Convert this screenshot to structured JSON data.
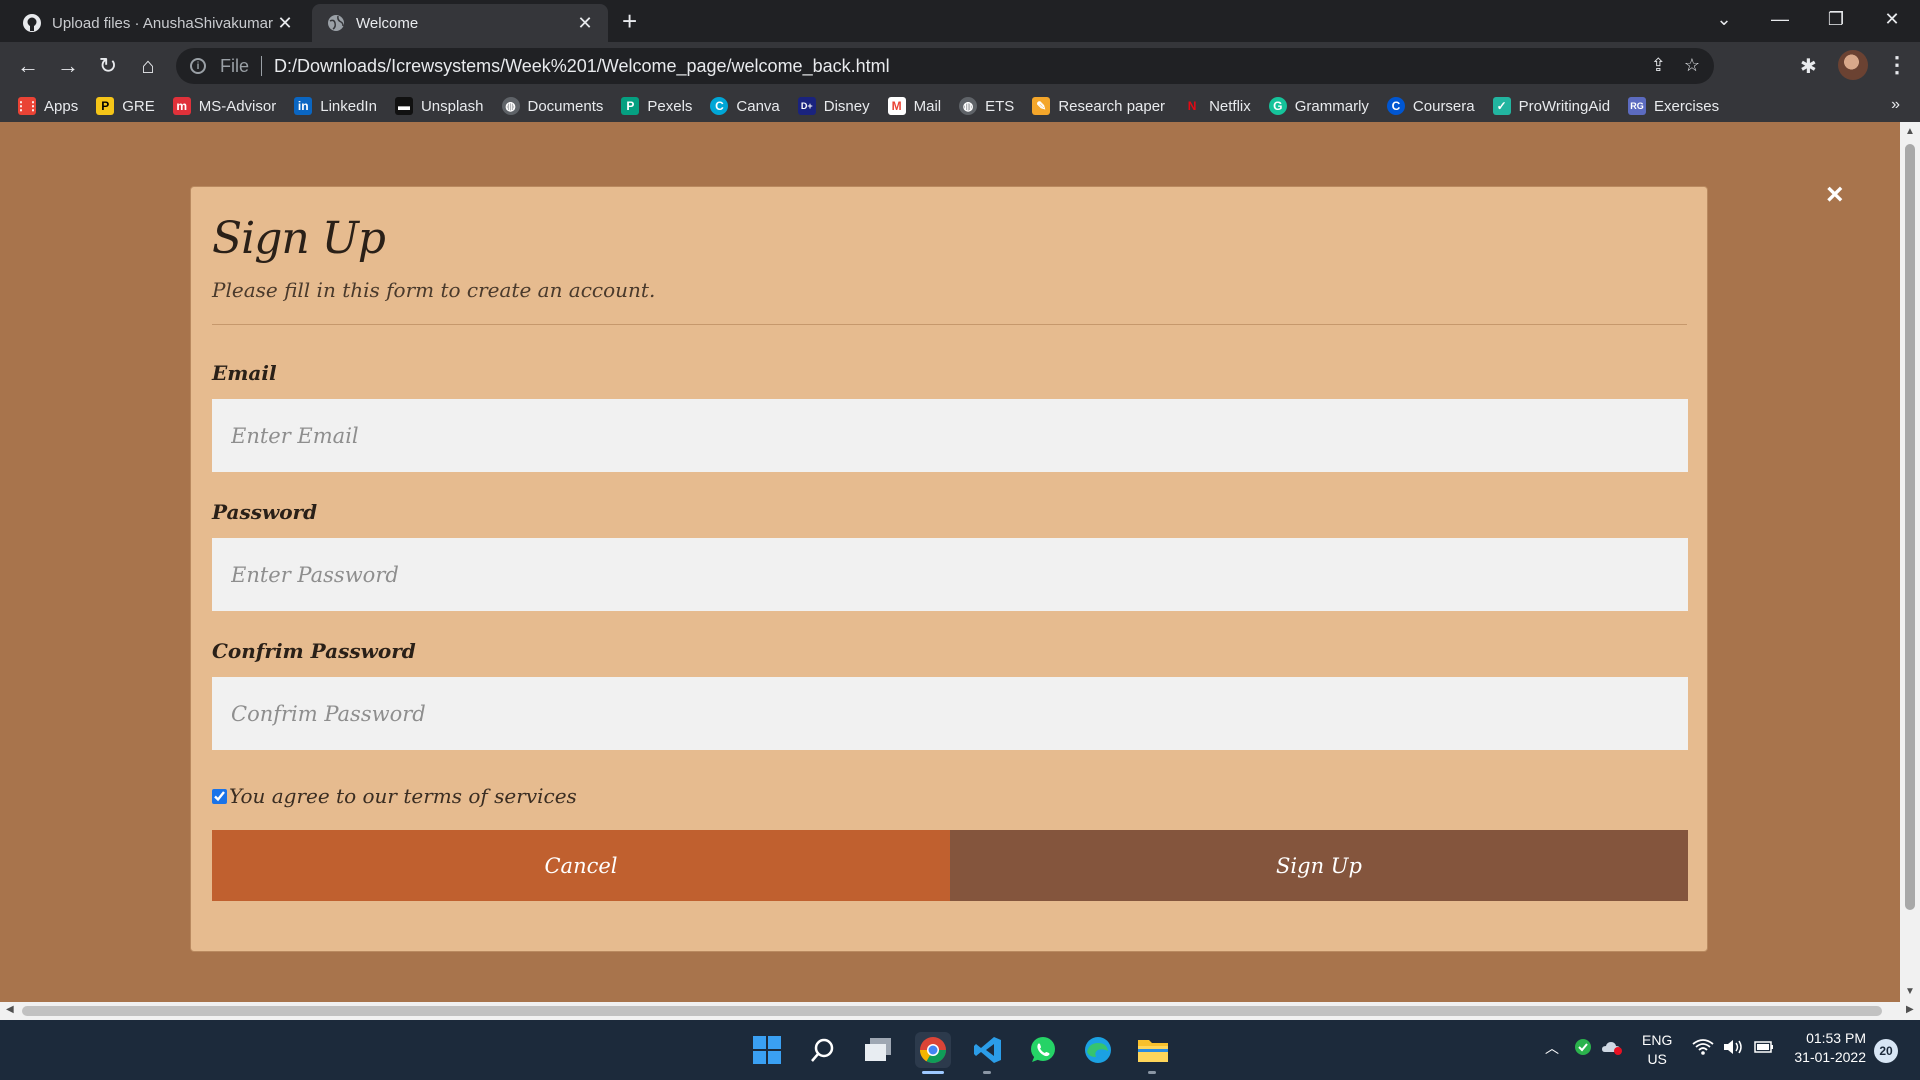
{
  "browser": {
    "tabs": [
      {
        "title": "Upload files · AnushaShivakumar",
        "icon": "github-icon",
        "active": false
      },
      {
        "title": "Welcome",
        "icon": "globe-icon",
        "active": true
      }
    ],
    "new_tab_label": "+",
    "address": {
      "scheme": "File",
      "url": "D:/Downloads/Icrewsystems/Week%201/Welcome_page/welcome_back.html"
    },
    "bookmarks": [
      {
        "label": "Apps",
        "icon": "apps-grid-icon",
        "color": "#ea4335"
      },
      {
        "label": "GRE",
        "icon": "gre-icon",
        "color": "#f5c518"
      },
      {
        "label": "MS-Advisor",
        "icon": "ms-advisor-icon",
        "color": "#e0313a"
      },
      {
        "label": "LinkedIn",
        "icon": "linkedin-icon",
        "color": "#0a66c2"
      },
      {
        "label": "Unsplash",
        "icon": "unsplash-icon",
        "color": "#111111"
      },
      {
        "label": "Documents",
        "icon": "globe-icon",
        "color": "#5f6368"
      },
      {
        "label": "Pexels",
        "icon": "pexels-icon",
        "color": "#05a081"
      },
      {
        "label": "Canva",
        "icon": "canva-icon",
        "color": "#00c4cc"
      },
      {
        "label": "Disney",
        "icon": "disney-icon",
        "color": "#1a237e"
      },
      {
        "label": "Mail",
        "icon": "gmail-icon",
        "color": "#ea4335"
      },
      {
        "label": "ETS",
        "icon": "globe-icon",
        "color": "#5f6368"
      },
      {
        "label": "Research paper",
        "icon": "research-icon",
        "color": "#f4a62a"
      },
      {
        "label": "Netflix",
        "icon": "netflix-icon",
        "color": "#e50914"
      },
      {
        "label": "Grammarly",
        "icon": "grammarly-icon",
        "color": "#15c39a"
      },
      {
        "label": "Coursera",
        "icon": "coursera-icon",
        "color": "#0056d2"
      },
      {
        "label": "ProWritingAid",
        "icon": "prowritingaid-icon",
        "color": "#22b5a0"
      },
      {
        "label": "Exercises",
        "icon": "exercises-icon",
        "color": "#5c6bc0"
      }
    ]
  },
  "modal": {
    "title": "Sign Up",
    "subtitle": "Please fill in this form to create an account.",
    "email": {
      "label": "Email",
      "placeholder": "Enter Email",
      "value": ""
    },
    "password": {
      "label": "Password",
      "placeholder": "Enter Password",
      "value": ""
    },
    "confirm": {
      "label": "Confrim Password",
      "placeholder": "Confrim Password",
      "value": ""
    },
    "terms": {
      "label": "You agree to our terms of services",
      "checked": true
    },
    "cancel_label": "Cancel",
    "signup_label": "Sign Up",
    "close_label": "×"
  },
  "colors": {
    "page_bg": "#a8744c",
    "modal_bg": "#e6bb8f",
    "cancel_bg": "#c0602f",
    "signup_bg": "#84553d"
  },
  "taskbar": {
    "apps": [
      "windows-start-icon",
      "search-icon",
      "task-view-icon",
      "chrome-icon",
      "vscode-icon",
      "whatsapp-icon",
      "edge-icon",
      "file-explorer-icon"
    ],
    "language": "ENG",
    "region": "US",
    "time": "01:53 PM",
    "date": "31-01-2022",
    "notifications": "20"
  }
}
